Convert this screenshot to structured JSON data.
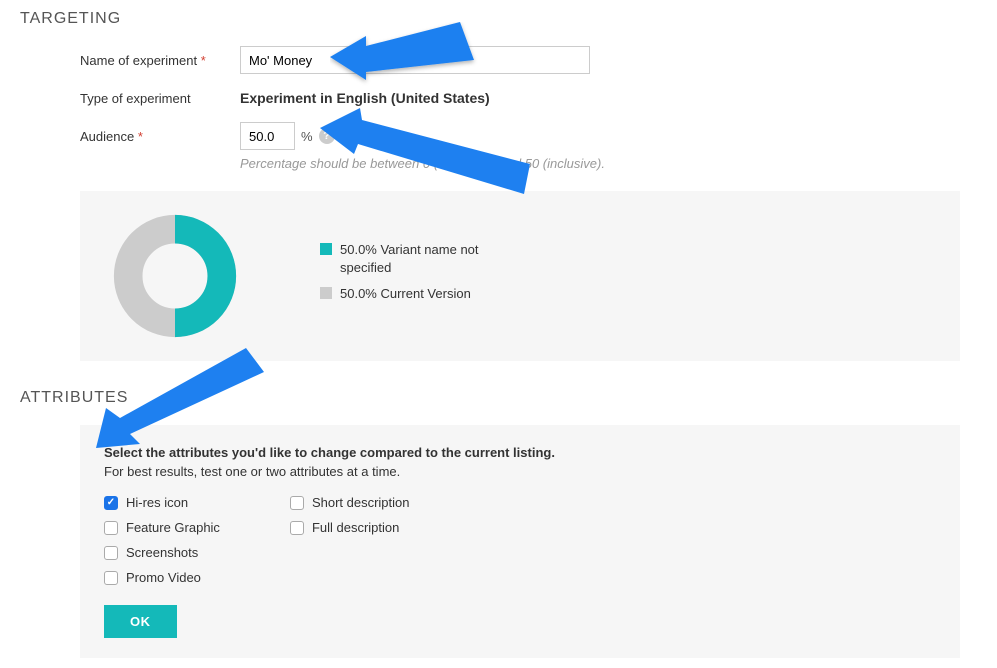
{
  "targeting": {
    "title": "TARGETING",
    "name_label": "Name of experiment",
    "name_value": "Mo' Money",
    "type_label": "Type of experiment",
    "type_value": "Experiment in English (United States)",
    "audience_label": "Audience",
    "audience_value": "50.0",
    "percent_sign": "%",
    "audience_hint": "Percentage should be between 0 (exclusive) and 50 (inclusive)."
  },
  "chart_data": {
    "type": "pie",
    "title": "",
    "series": [
      {
        "name": "Variant name not specified",
        "value": 50.0,
        "color": "#14b9b9",
        "legend_label": "50.0% Variant name not specified"
      },
      {
        "name": "Current Version",
        "value": 50.0,
        "color": "#cccccc",
        "legend_label": "50.0% Current Version"
      }
    ]
  },
  "attributes": {
    "title": "ATTRIBUTES",
    "heading": "Select the attributes you'd like to change compared to the current listing.",
    "subheading": "For best results, test one or two attributes at a time.",
    "items": [
      {
        "label": "Hi-res icon",
        "checked": true
      },
      {
        "label": "Feature Graphic",
        "checked": false
      },
      {
        "label": "Screenshots",
        "checked": false
      },
      {
        "label": "Promo Video",
        "checked": false
      },
      {
        "label": "Short description",
        "checked": false
      },
      {
        "label": "Full description",
        "checked": false
      }
    ],
    "ok_label": "OK"
  },
  "colors": {
    "teal": "#14b9b9",
    "grey": "#cccccc",
    "arrow": "#1e80f0"
  }
}
